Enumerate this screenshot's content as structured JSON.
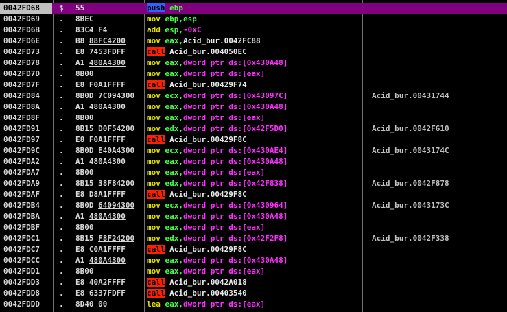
{
  "colors": {
    "background": "#000000",
    "selected_row": "#800080",
    "address_selected_bg": "#c0c0c0",
    "mnemonic": "#e0e000",
    "call_bg": "#ff2000",
    "push_bg": "#3060ff",
    "register": "#40ff40",
    "memory": "#ff30ff"
  },
  "rows": [
    {
      "address": "0042FD68",
      "flag": "$",
      "hex": "55",
      "mnemonic": "push",
      "operands": [
        {
          "t": "ebp",
          "k": "reg"
        }
      ],
      "comment": "",
      "selected": true
    },
    {
      "address": "0042FD69",
      "flag": ".",
      "hex": "8BEC",
      "mnemonic": "mov",
      "operands": [
        {
          "t": "ebp,esp",
          "k": "reg"
        }
      ],
      "comment": ""
    },
    {
      "address": "0042FD6B",
      "flag": ".",
      "hex": "83C4 F4",
      "mnemonic": "add",
      "operands": [
        {
          "t": "esp,",
          "k": "reg"
        },
        {
          "t": "-0xC",
          "k": "mem"
        }
      ],
      "comment": ""
    },
    {
      "address": "0042FD6E",
      "flag": ".",
      "hex": "B8 88FC4200",
      "hex_ul": "88FC4200",
      "mnemonic": "mov",
      "operands": [
        {
          "t": "eax,",
          "k": "reg"
        },
        {
          "t": "Acid_bur.0042FC88",
          "k": "plain"
        }
      ],
      "comment": ""
    },
    {
      "address": "0042FD73",
      "flag": ".",
      "hex": "E8 7453FDFF",
      "mnemonic": "call",
      "operands": [
        {
          "t": "Acid_bur.004050EC",
          "k": "plain"
        }
      ],
      "comment": ""
    },
    {
      "address": "0042FD78",
      "flag": ".",
      "hex": "A1 480A4300",
      "hex_ul": "480A4300",
      "mnemonic": "mov",
      "operands": [
        {
          "t": "eax,",
          "k": "reg"
        },
        {
          "t": "dword ptr ds:[0x430A48]",
          "k": "mem"
        }
      ],
      "comment": ""
    },
    {
      "address": "0042FD7D",
      "flag": ".",
      "hex": "8B00",
      "mnemonic": "mov",
      "operands": [
        {
          "t": "eax,",
          "k": "reg"
        },
        {
          "t": "dword ptr ds:[eax]",
          "k": "mem"
        }
      ],
      "comment": ""
    },
    {
      "address": "0042FD7F",
      "flag": ".",
      "hex": "E8 F0A1FFFF",
      "mnemonic": "call",
      "operands": [
        {
          "t": "Acid_bur.00429F74",
          "k": "plain"
        }
      ],
      "comment": ""
    },
    {
      "address": "0042FD84",
      "flag": ".",
      "hex": "8B0D 7C094300",
      "hex_ul": "7C094300",
      "mnemonic": "mov",
      "operands": [
        {
          "t": "ecx,",
          "k": "reg"
        },
        {
          "t": "dword ptr ds:[0x43097C]",
          "k": "mem"
        }
      ],
      "comment": "Acid_bur.00431744"
    },
    {
      "address": "0042FD8A",
      "flag": ".",
      "hex": "A1 480A4300",
      "hex_ul": "480A4300",
      "mnemonic": "mov",
      "operands": [
        {
          "t": "eax,",
          "k": "reg"
        },
        {
          "t": "dword ptr ds:[0x430A48]",
          "k": "mem"
        }
      ],
      "comment": ""
    },
    {
      "address": "0042FD8F",
      "flag": ".",
      "hex": "8B00",
      "mnemonic": "mov",
      "operands": [
        {
          "t": "eax,",
          "k": "reg"
        },
        {
          "t": "dword ptr ds:[eax]",
          "k": "mem"
        }
      ],
      "comment": ""
    },
    {
      "address": "0042FD91",
      "flag": ".",
      "hex": "8B15 D0F54200",
      "hex_ul": "D0F54200",
      "mnemonic": "mov",
      "operands": [
        {
          "t": "edx,",
          "k": "reg"
        },
        {
          "t": "dword ptr ds:[0x42F5D0]",
          "k": "mem"
        }
      ],
      "comment": "Acid_bur.0042F610"
    },
    {
      "address": "0042FD97",
      "flag": ".",
      "hex": "E8 F0A1FFFF",
      "mnemonic": "call",
      "operands": [
        {
          "t": "Acid_bur.00429F8C",
          "k": "plain"
        }
      ],
      "comment": ""
    },
    {
      "address": "0042FD9C",
      "flag": ".",
      "hex": "8B0D E40A4300",
      "hex_ul": "E40A4300",
      "mnemonic": "mov",
      "operands": [
        {
          "t": "ecx,",
          "k": "reg"
        },
        {
          "t": "dword ptr ds:[0x430AE4]",
          "k": "mem"
        }
      ],
      "comment": "Acid_bur.0043174C"
    },
    {
      "address": "0042FDA2",
      "flag": ".",
      "hex": "A1 480A4300",
      "hex_ul": "480A4300",
      "mnemonic": "mov",
      "operands": [
        {
          "t": "eax,",
          "k": "reg"
        },
        {
          "t": "dword ptr ds:[0x430A48]",
          "k": "mem"
        }
      ],
      "comment": ""
    },
    {
      "address": "0042FDA7",
      "flag": ".",
      "hex": "8B00",
      "mnemonic": "mov",
      "operands": [
        {
          "t": "eax,",
          "k": "reg"
        },
        {
          "t": "dword ptr ds:[eax]",
          "k": "mem"
        }
      ],
      "comment": ""
    },
    {
      "address": "0042FDA9",
      "flag": ".",
      "hex": "8B15 38F84200",
      "hex_ul": "38F84200",
      "mnemonic": "mov",
      "operands": [
        {
          "t": "edx,",
          "k": "reg"
        },
        {
          "t": "dword ptr ds:[0x42F838]",
          "k": "mem"
        }
      ],
      "comment": "Acid_bur.0042F878"
    },
    {
      "address": "0042FDAF",
      "flag": ".",
      "hex": "E8 D8A1FFFF",
      "mnemonic": "call",
      "operands": [
        {
          "t": "Acid_bur.00429F8C",
          "k": "plain"
        }
      ],
      "comment": ""
    },
    {
      "address": "0042FDB4",
      "flag": ".",
      "hex": "8B0D 64094300",
      "hex_ul": "64094300",
      "mnemonic": "mov",
      "operands": [
        {
          "t": "ecx,",
          "k": "reg"
        },
        {
          "t": "dword ptr ds:[0x430964]",
          "k": "mem"
        }
      ],
      "comment": "Acid_bur.0043173C"
    },
    {
      "address": "0042FDBA",
      "flag": ".",
      "hex": "A1 480A4300",
      "hex_ul": "480A4300",
      "mnemonic": "mov",
      "operands": [
        {
          "t": "eax,",
          "k": "reg"
        },
        {
          "t": "dword ptr ds:[0x430A48]",
          "k": "mem"
        }
      ],
      "comment": ""
    },
    {
      "address": "0042FDBF",
      "flag": ".",
      "hex": "8B00",
      "mnemonic": "mov",
      "operands": [
        {
          "t": "eax,",
          "k": "reg"
        },
        {
          "t": "dword ptr ds:[eax]",
          "k": "mem"
        }
      ],
      "comment": ""
    },
    {
      "address": "0042FDC1",
      "flag": ".",
      "hex": "8B15 F8F24200",
      "hex_ul": "F8F24200",
      "mnemonic": "mov",
      "operands": [
        {
          "t": "edx,",
          "k": "reg"
        },
        {
          "t": "dword ptr ds:[0x42F2F8]",
          "k": "mem"
        }
      ],
      "comment": "Acid_bur.0042F338"
    },
    {
      "address": "0042FDC7",
      "flag": ".",
      "hex": "E8 C0A1FFFF",
      "mnemonic": "call",
      "operands": [
        {
          "t": "Acid_bur.00429F8C",
          "k": "plain"
        }
      ],
      "comment": ""
    },
    {
      "address": "0042FDCC",
      "flag": ".",
      "hex": "A1 480A4300",
      "hex_ul": "480A4300",
      "mnemonic": "mov",
      "operands": [
        {
          "t": "eax,",
          "k": "reg"
        },
        {
          "t": "dword ptr ds:[0x430A48]",
          "k": "mem"
        }
      ],
      "comment": ""
    },
    {
      "address": "0042FDD1",
      "flag": ".",
      "hex": "8B00",
      "mnemonic": "mov",
      "operands": [
        {
          "t": "eax,",
          "k": "reg"
        },
        {
          "t": "dword ptr ds:[eax]",
          "k": "mem"
        }
      ],
      "comment": ""
    },
    {
      "address": "0042FDD3",
      "flag": ".",
      "hex": "E8 40A2FFFF",
      "mnemonic": "call",
      "operands": [
        {
          "t": "Acid_bur.0042A018",
          "k": "plain"
        }
      ],
      "comment": ""
    },
    {
      "address": "0042FDD8",
      "flag": ".",
      "hex": "E8 6337FDFF",
      "mnemonic": "call",
      "operands": [
        {
          "t": "Acid_bur.00403540",
          "k": "plain"
        }
      ],
      "comment": ""
    },
    {
      "address": "0042FDDD",
      "flag": ".",
      "hex": "8D40 00",
      "mnemonic": "lea",
      "operands": [
        {
          "t": "eax,",
          "k": "reg"
        },
        {
          "t": "dword ptr ds:[eax]",
          "k": "mem"
        }
      ],
      "comment": ""
    }
  ]
}
